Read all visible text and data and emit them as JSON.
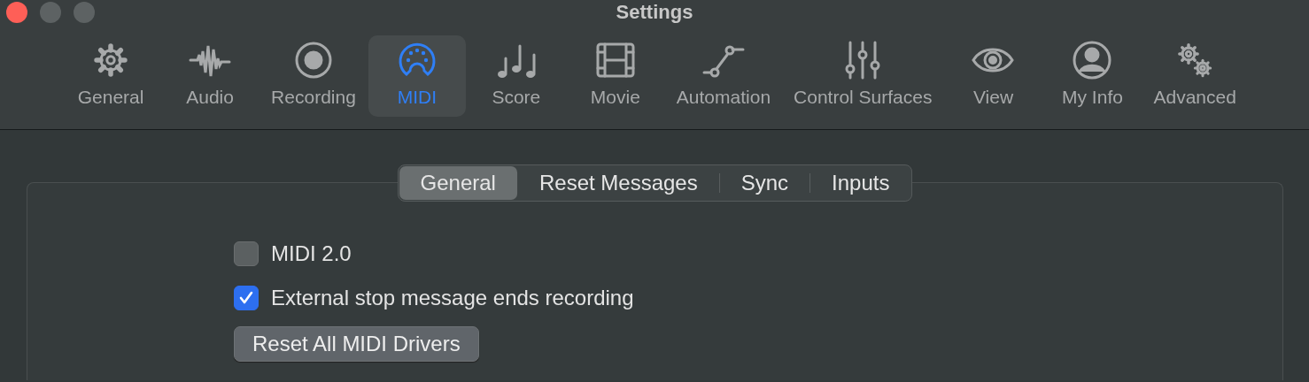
{
  "window": {
    "title": "Settings"
  },
  "toolbar": [
    {
      "label": "General",
      "kind": "gear",
      "selected": false
    },
    {
      "label": "Audio",
      "kind": "wave",
      "selected": false
    },
    {
      "label": "Recording",
      "kind": "record",
      "selected": false
    },
    {
      "label": "MIDI",
      "kind": "midi",
      "selected": true
    },
    {
      "label": "Score",
      "kind": "notes",
      "selected": false
    },
    {
      "label": "Movie",
      "kind": "film",
      "selected": false
    },
    {
      "label": "Automation",
      "kind": "automation",
      "selected": false
    },
    {
      "label": "Control Surfaces",
      "kind": "faders",
      "selected": false
    },
    {
      "label": "View",
      "kind": "eye",
      "selected": false
    },
    {
      "label": "My Info",
      "kind": "person",
      "selected": false
    },
    {
      "label": "Advanced",
      "kind": "gears",
      "selected": false
    }
  ],
  "tabs": [
    {
      "label": "General",
      "selected": true
    },
    {
      "label": "Reset Messages",
      "selected": false
    },
    {
      "label": "Sync",
      "selected": false
    },
    {
      "label": "Inputs",
      "selected": false
    }
  ],
  "options": [
    {
      "kind": "checkbox",
      "label": "MIDI 2.0",
      "checked": false
    },
    {
      "kind": "checkbox",
      "label": "External stop message ends recording",
      "checked": true
    },
    {
      "kind": "button",
      "label": "Reset All MIDI Drivers"
    }
  ]
}
